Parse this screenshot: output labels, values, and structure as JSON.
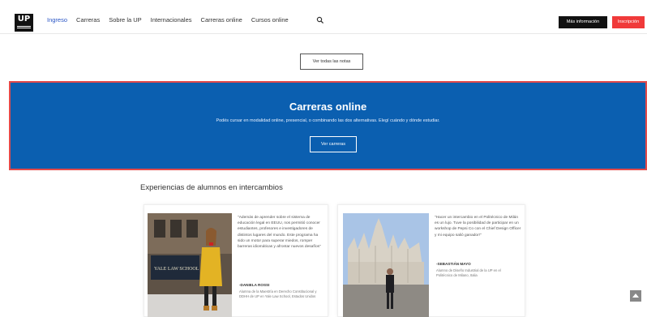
{
  "header": {
    "logo_text": "UP",
    "nav": [
      {
        "label": "Ingreso",
        "active": true
      },
      {
        "label": "Carreras",
        "active": false
      },
      {
        "label": "Sobre la UP",
        "active": false
      },
      {
        "label": "Internacionales",
        "active": false
      },
      {
        "label": "Carreras online",
        "active": false
      },
      {
        "label": "Cursos online",
        "active": false
      }
    ],
    "search_icon": "search-icon",
    "info_button": "Más información",
    "inscripcion_button": "Inscripción"
  },
  "notas_button": "Ver todas las notas",
  "banner": {
    "title": "Carreras online",
    "text": "Podés cursar en modalidad online, presencial, o combinando las dos alternativas. Elegí cuándo y dónde estudiar.",
    "button": "Ver carreras",
    "color": "#0b5fb0",
    "border_color": "#e34a4a"
  },
  "experiences": {
    "title": "Experiencias de alumnos en intercambios",
    "cards": [
      {
        "quote": "\"Además de aprender sobre el sistema de educación legal en EEUU, nos permitió conocer estudiantes, profesores e investigadores de distintos lugares del mundo. Este programa ha sido un motor para superar miedos, romper barreras idiomáticas y afrontar nuevos desafíos\"",
        "author": "-DANIELA ROSSI",
        "author_desc": "Alumna de la Maestría en Derecho Constitucional y DDHH de UP en Yale Law School, Estados Unidos"
      },
      {
        "quote": "\"Hacer un intercambio en el Politécnico de Milán es un lujo. Tuve la posibilidad de participar en un workshop de Pepsi Co con el Chief Design Officer y mi equipo salió ganador!\"",
        "author": "-SEBASTIÁN MAYO",
        "author_desc": "Alumno de Diseño Industrial de la UP en el Politécnico de Milano, Italia"
      }
    ]
  },
  "photo_labels": {
    "yale_sign": "YALE LAW SCHOOL"
  }
}
